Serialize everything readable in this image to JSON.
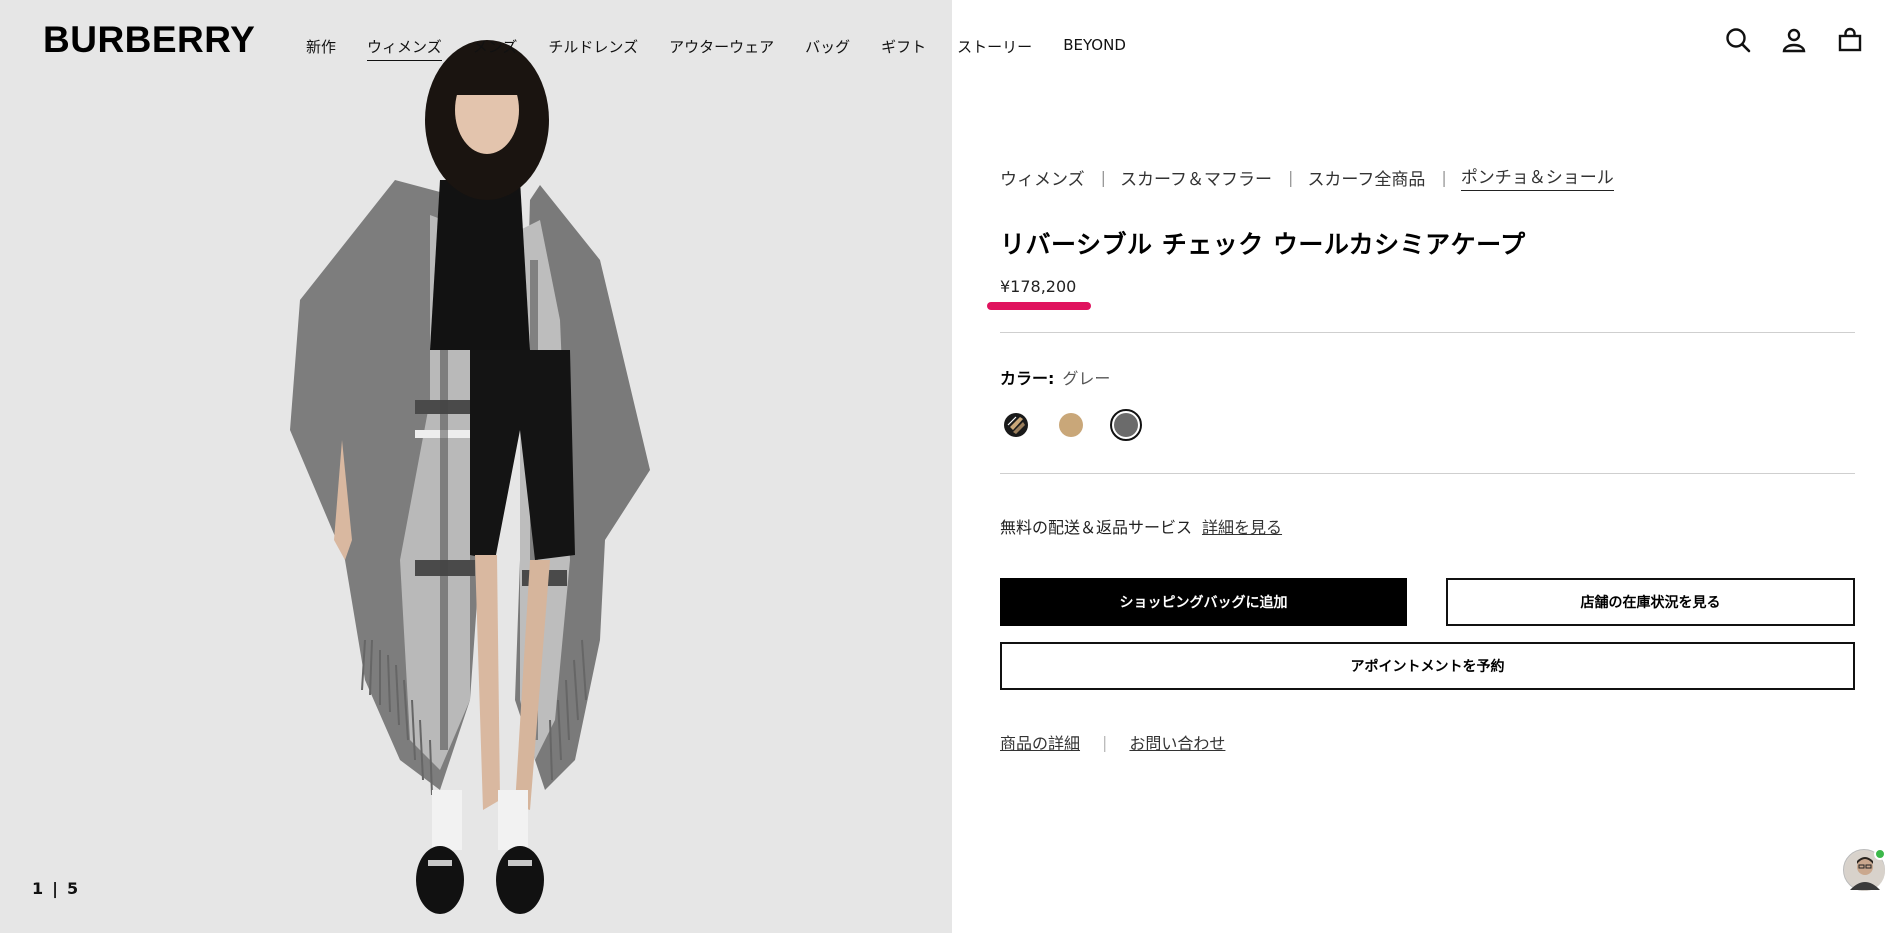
{
  "header": {
    "logo": "BURBERRY",
    "nav": [
      "新作",
      "ウィメンズ",
      "メンズ",
      "チルドレンズ",
      "アウターウェア",
      "バッグ",
      "ギフト",
      "ストーリー",
      "BEYOND"
    ],
    "active_nav": "ウィメンズ",
    "icons": [
      "search-icon",
      "account-icon",
      "shopping-bag-icon"
    ]
  },
  "gallery": {
    "current": "1",
    "separator": "|",
    "total": "5"
  },
  "breadcrumb": [
    "ウィメンズ",
    "スカーフ＆マフラー",
    "スカーフ全商品",
    "ポンチョ＆ショール"
  ],
  "product": {
    "title": "リバーシブル チェック ウールカシミアケープ",
    "price": "¥178,200",
    "color_label": "カラー:",
    "color_value": "グレー",
    "swatches": [
      {
        "name": "check",
        "color": "#1a1a1a",
        "selected": false
      },
      {
        "name": "beige",
        "color": "#c9a779",
        "selected": false
      },
      {
        "name": "grey",
        "color": "#6b6b6b",
        "selected": true
      }
    ]
  },
  "delivery": {
    "text": "無料の配送＆返品サービス",
    "link": "詳細を見る"
  },
  "buttons": {
    "add_to_bag": "ショッピングバッグに追加",
    "store_stock": "店舗の在庫状況を見る",
    "appointment": "アポイントメントを予約"
  },
  "footer_links": [
    "商品の詳細",
    "お問い合わせ"
  ],
  "colors": {
    "accent_underline": "#e0135e",
    "primary_button": "#000000"
  }
}
